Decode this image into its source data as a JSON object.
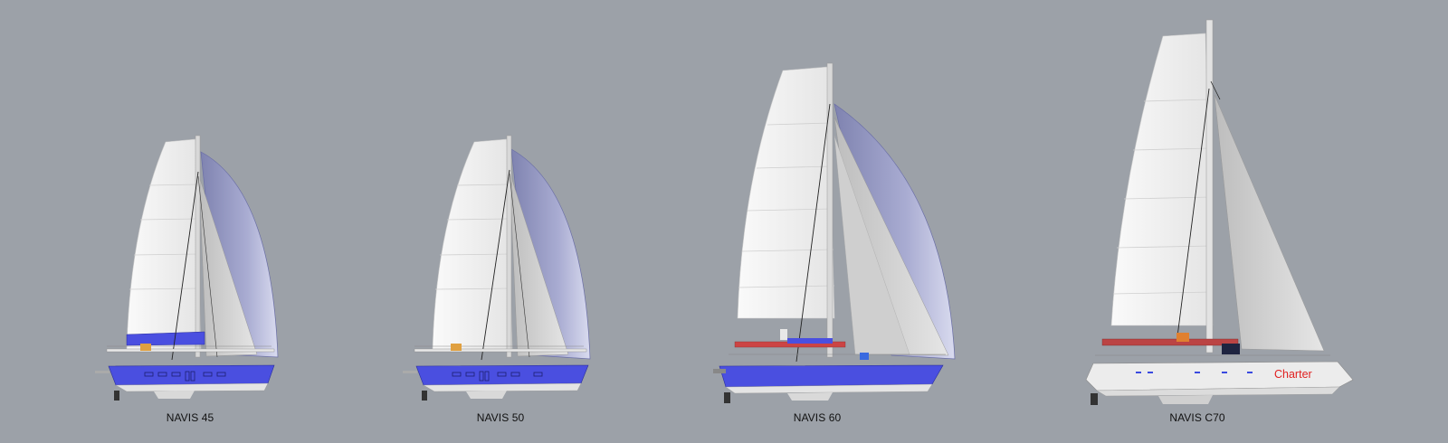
{
  "boats": [
    {
      "name": "NAVIS 45",
      "hull_color": "#4a4fe0"
    },
    {
      "name": "NAVIS 50",
      "hull_color": "#4a4fe0"
    },
    {
      "name": "NAVIS 60",
      "hull_color": "#4a4fe0"
    },
    {
      "name": "NAVIS C70",
      "hull_color": "#ececec",
      "hull_text": "Charter",
      "hull_text_color": "#e02020"
    }
  ],
  "colors": {
    "background": "#9ca1a8",
    "mainsail": "#f2f2f2",
    "jib": "#d8d8d8",
    "gennaker": "#a8abd0"
  }
}
